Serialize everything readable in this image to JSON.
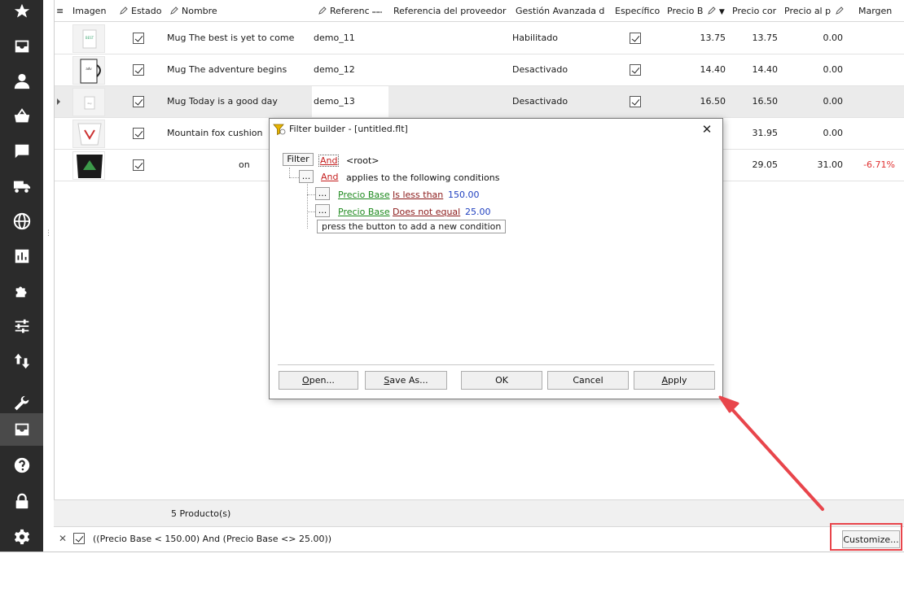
{
  "grid": {
    "columns": [
      {
        "key": "menu",
        "label": "≡"
      },
      {
        "key": "image",
        "label": "Imagen"
      },
      {
        "key": "estado",
        "label": "Estado"
      },
      {
        "key": "nombre",
        "label": "Nombre"
      },
      {
        "key": "referencia",
        "label": "Referenc"
      },
      {
        "key": "ref_proveedor",
        "label": "Referencia del proveedor"
      },
      {
        "key": "gestion",
        "label": "Gestión Avanzada de"
      },
      {
        "key": "especifico",
        "label": "Específico"
      },
      {
        "key": "precio_base",
        "label": "Precio B"
      },
      {
        "key": "precio_con",
        "label": "Precio cor"
      },
      {
        "key": "precio_al",
        "label": "Precio al p"
      },
      {
        "key": "margen",
        "label": "Margen"
      }
    ],
    "rows": [
      {
        "name": "Mug The best is yet to come",
        "ref": "demo_11",
        "gestion": "Habilitado",
        "precio_base": "13.75",
        "precio_con": "13.75",
        "precio_al": "0.00",
        "margen": ""
      },
      {
        "name": "Mug The adventure begins",
        "ref": "demo_12",
        "gestion": "Desactivado",
        "precio_base": "14.40",
        "precio_con": "14.40",
        "precio_al": "0.00",
        "margen": ""
      },
      {
        "name": "Mug Today is a good day",
        "ref": "demo_13",
        "gestion": "Desactivado",
        "precio_base": "16.50",
        "precio_con": "16.50",
        "precio_al": "0.00",
        "margen": ""
      },
      {
        "name": "Mountain fox cushion",
        "ref": "",
        "gestion": "",
        "precio_base": "",
        "precio_con": "31.95",
        "precio_al": "0.00",
        "margen": ""
      },
      {
        "name": "on",
        "ref": "",
        "gestion": "",
        "precio_base": "",
        "precio_con": "29.05",
        "precio_al": "31.00",
        "margen": "-6.71%"
      }
    ]
  },
  "footer": {
    "count": "5 Producto(s)",
    "filter_text": "((Precio Base < 150.00) And (Precio Base <> 25.00))",
    "customize_label": "Customize..."
  },
  "dialog": {
    "title": "Filter builder - [untitled.flt]",
    "close": "✕",
    "filter_button": "Filter",
    "root_op": "And",
    "root_label": "<root>",
    "group_button": "...",
    "group_op": "And",
    "group_label": "applies to the following conditions",
    "conditions": [
      {
        "button": "...",
        "field": "Precio Base",
        "operator": "Is less than",
        "value": "150.00"
      },
      {
        "button": "...",
        "field": "Precio Base",
        "operator": "Does not equal",
        "value": "25.00"
      }
    ],
    "add_hint": "press the button to add a new condition",
    "buttons": {
      "open": "Open...",
      "save_as": "Save As...",
      "ok": "OK",
      "cancel": "Cancel",
      "apply": "Apply"
    }
  },
  "colors": {
    "sidebar": "#2b2b2b",
    "highlight": "#e8454b",
    "negative": "#e03030"
  },
  "sidebar_icons": [
    "star-icon",
    "inbox-icon",
    "user-icon",
    "basket-icon",
    "chat-icon",
    "truck-icon",
    "globe-icon",
    "chart-icon",
    "puzzle-icon",
    "sliders-icon",
    "sort-arrows-icon",
    "wrench-icon",
    "catalog-icon",
    "help-icon",
    "lock-icon",
    "gear-icon"
  ]
}
